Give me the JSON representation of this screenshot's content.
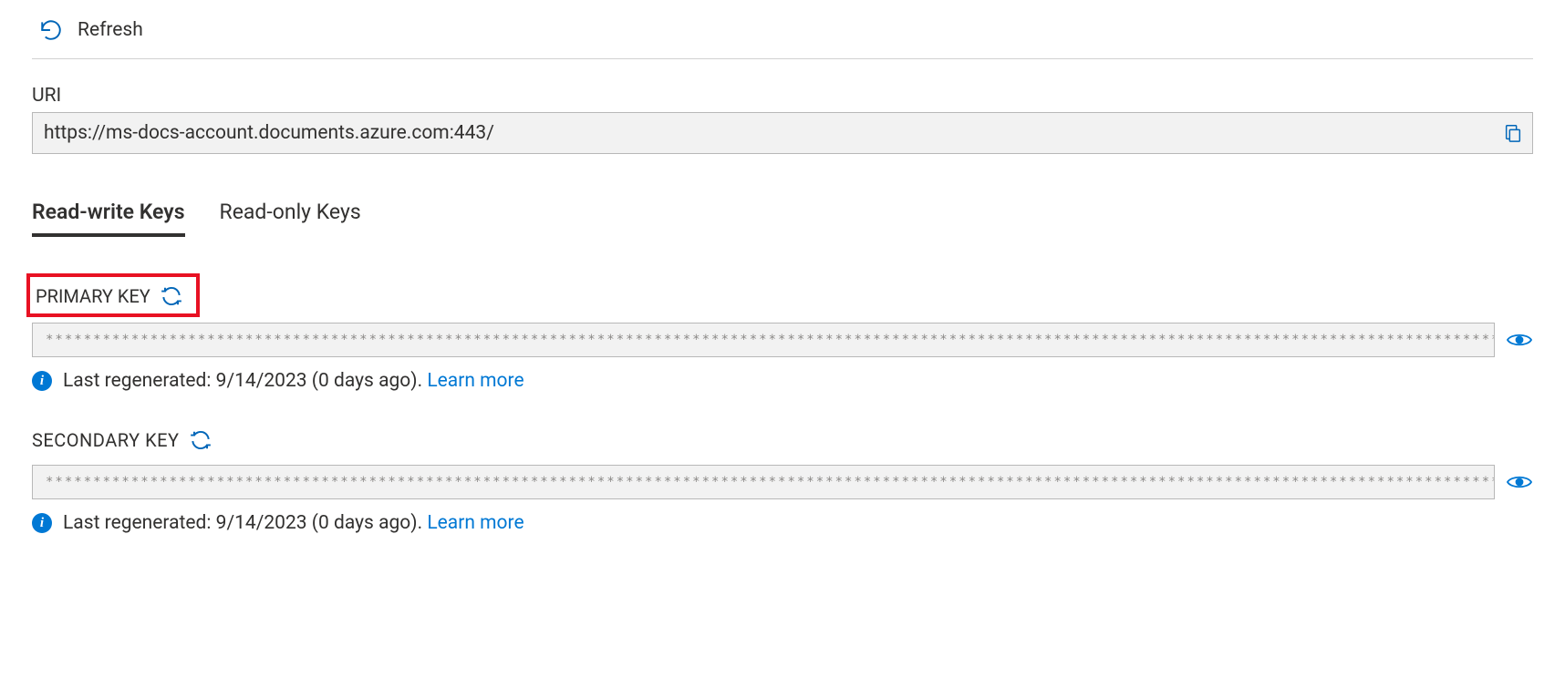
{
  "toolbar": {
    "refresh_label": "Refresh"
  },
  "uri": {
    "label": "URI",
    "value": "https://ms-docs-account.documents.azure.com:443/"
  },
  "tabs": {
    "read_write": "Read-write Keys",
    "read_only": "Read-only Keys"
  },
  "primary": {
    "label": "PRIMARY KEY",
    "masked": "***********************************************************************************************************************************************************************",
    "info_text": "Last regenerated: 9/14/2023 (0 days ago). ",
    "learn_more": "Learn more"
  },
  "secondary": {
    "label": "SECONDARY KEY",
    "masked": "***********************************************************************************************************************************************************************",
    "info_text": "Last regenerated: 9/14/2023 (0 days ago). ",
    "learn_more": "Learn more"
  }
}
